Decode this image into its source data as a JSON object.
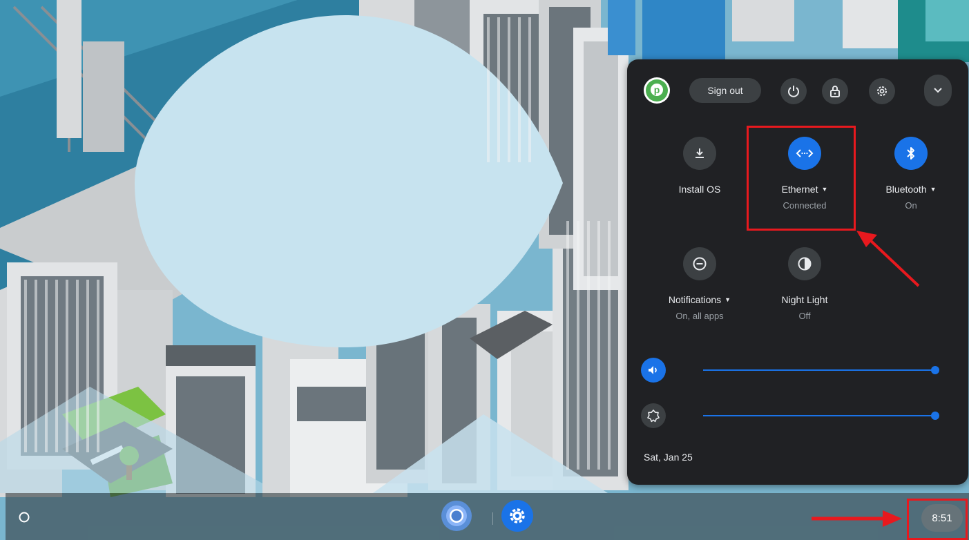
{
  "wallpaper": {
    "sky_color": "#7ab6cf",
    "drop_color": "#c7e3ef"
  },
  "quick_settings": {
    "avatar_letter": "p",
    "sign_out_label": "Sign out",
    "power_icon": "power-icon",
    "lock_icon": "lock-icon",
    "settings_icon": "gear-icon",
    "collapse_icon": "chevron-down-icon",
    "tiles": [
      {
        "icon": "download-icon",
        "label": "Install OS",
        "sublabel": "",
        "active": false,
        "has_menu": false
      },
      {
        "icon": "ethernet-icon",
        "label": "Ethernet",
        "sublabel": "Connected",
        "active": true,
        "has_menu": true
      },
      {
        "icon": "bluetooth-icon",
        "label": "Bluetooth",
        "sublabel": "On",
        "active": true,
        "has_menu": true
      },
      {
        "icon": "do-not-disturb-icon",
        "label": "Notifications",
        "sublabel": "On, all apps",
        "active": false,
        "has_menu": true
      },
      {
        "icon": "night-light-icon",
        "label": "Night Light",
        "sublabel": "Off",
        "active": false,
        "has_menu": false
      }
    ],
    "volume": {
      "icon": "volume-icon",
      "level": 1.0
    },
    "brightness": {
      "icon": "brightness-icon",
      "level": 1.0
    },
    "date": "Sat, Jan 25"
  },
  "shelf": {
    "launcher_icon": "launcher-icon",
    "apps": [
      {
        "name": "chrome-icon"
      },
      {
        "name": "settings-app-icon"
      }
    ],
    "time": "8:51"
  },
  "colors": {
    "panel_bg": "#202124",
    "accent": "#1a73e8",
    "annotation": "#e8191e"
  }
}
